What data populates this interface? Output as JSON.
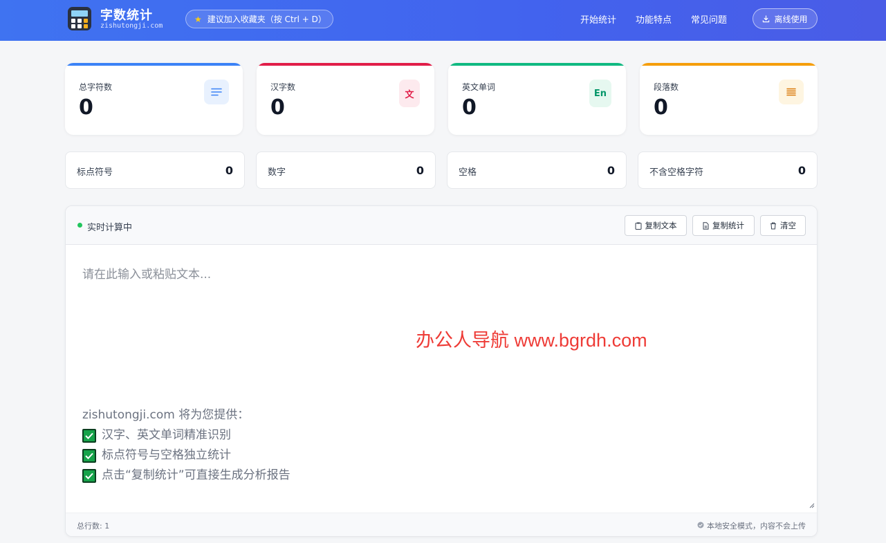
{
  "header": {
    "brand_title": "字数统计",
    "brand_subtitle": "zishutongji.com",
    "bookmark_tip": "建议加入收藏夹（按 Ctrl + D）",
    "nav": [
      "开始统计",
      "功能特点",
      "常见问题"
    ],
    "offline_label": "离线使用",
    "gradient_colors": [
      "#3f73f1",
      "#4a5ce6"
    ]
  },
  "stats": [
    {
      "label": "总字符数",
      "value": "0",
      "icon": "lines-icon",
      "icon_text": "",
      "color": "#3b82f6"
    },
    {
      "label": "汉字数",
      "value": "0",
      "icon": "chinese-char-icon",
      "icon_text": "文",
      "color": "#e11d48"
    },
    {
      "label": "英文单词",
      "value": "0",
      "icon": "english-icon",
      "icon_text": "En",
      "color": "#10b981"
    },
    {
      "label": "段落数",
      "value": "0",
      "icon": "paragraph-icon",
      "icon_text": "",
      "color": "#f59e0b"
    }
  ],
  "mini_stats": [
    {
      "label": "标点符号",
      "value": "0"
    },
    {
      "label": "数字",
      "value": "0"
    },
    {
      "label": "空格",
      "value": "0"
    },
    {
      "label": "不含空格字符",
      "value": "0"
    }
  ],
  "editor": {
    "status": "实时计算中",
    "copy_text_label": "复制文本",
    "copy_stats_label": "复制统计",
    "clear_label": "清空",
    "placeholder": "请在此输入或粘贴文本...",
    "promo_intro": "zishutongji.com 将为您提供：",
    "promo_items": [
      "汉字、英文单词精准识别",
      "标点符号与空格独立统计",
      "点击“复制统计”可直接生成分析报告"
    ],
    "watermark": "办公人导航 www.bgrdh.com",
    "line_count": "总行数: 1",
    "secure_note": "本地安全模式，内容不会上传"
  }
}
